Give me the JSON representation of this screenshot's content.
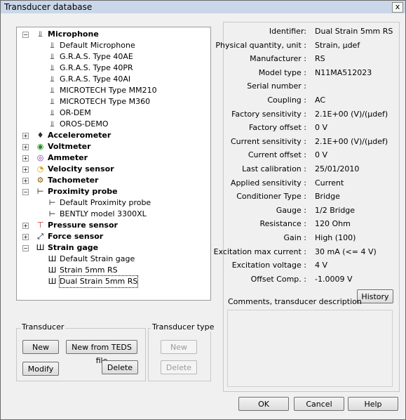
{
  "window": {
    "title": "Transducer database",
    "close": "x"
  },
  "tree": {
    "nodes": [
      {
        "label": "Microphone",
        "icon": "microphone-icon",
        "category": true,
        "expanded": true
      },
      {
        "label": "Default Microphone",
        "icon": "microphone-icon"
      },
      {
        "label": "G.R.A.S. Type 40AE",
        "icon": "microphone-icon"
      },
      {
        "label": "G.R.A.S. Type 40PR",
        "icon": "microphone-icon"
      },
      {
        "label": "G.R.A.S. Type 40AI",
        "icon": "microphone-icon"
      },
      {
        "label": "MICROTECH Type MM210",
        "icon": "microphone-icon"
      },
      {
        "label": "MICROTECH Type M360",
        "icon": "microphone-icon"
      },
      {
        "label": "OR-DEM",
        "icon": "microphone-icon"
      },
      {
        "label": "OROS-DEMO",
        "icon": "microphone-icon"
      },
      {
        "label": "Accelerometer",
        "icon": "accelerometer-icon",
        "category": true,
        "expanded": false
      },
      {
        "label": "Voltmeter",
        "icon": "voltmeter-icon",
        "category": true,
        "expanded": false
      },
      {
        "label": "Ammeter",
        "icon": "ammeter-icon",
        "category": true,
        "expanded": false
      },
      {
        "label": "Velocity sensor",
        "icon": "velocity-sensor-icon",
        "category": true,
        "expanded": false
      },
      {
        "label": "Tachometer",
        "icon": "tachometer-icon",
        "category": true,
        "expanded": false
      },
      {
        "label": "Proximity probe",
        "icon": "proximity-probe-icon",
        "category": true,
        "expanded": true
      },
      {
        "label": "Default Proximity probe",
        "icon": "proximity-probe-icon"
      },
      {
        "label": "BENTLY model 3300XL",
        "icon": "proximity-probe-icon"
      },
      {
        "label": "Pressure sensor",
        "icon": "pressure-sensor-icon",
        "category": true,
        "expanded": false
      },
      {
        "label": "Force sensor",
        "icon": "force-sensor-icon",
        "category": true,
        "expanded": false
      },
      {
        "label": "Strain gage",
        "icon": "strain-gage-icon",
        "category": true,
        "expanded": true
      },
      {
        "label": "Default Strain gage",
        "icon": "strain-gage-icon"
      },
      {
        "label": "Strain 5mm RS",
        "icon": "strain-gage-icon"
      },
      {
        "label": "Dual Strain 5mm RS",
        "icon": "strain-gage-icon",
        "selected": true
      }
    ]
  },
  "properties": [
    {
      "label": "Identifier:",
      "value": "Dual Strain 5mm RS"
    },
    {
      "label": "Physical quantity, unit :",
      "value": "Strain, µdef"
    },
    {
      "label": "Manufacturer :",
      "value": "RS"
    },
    {
      "label": "Model type :",
      "value": "N11MA512023"
    },
    {
      "label": "Serial number :",
      "value": ""
    },
    {
      "label": "Coupling :",
      "value": "AC"
    },
    {
      "label": "Factory sensitivity :",
      "value": "2.1E+00 (V)/(µdef)"
    },
    {
      "label": "Factory offset :",
      "value": "0 V"
    },
    {
      "label": "Current sensitivity :",
      "value": "2.1E+00 (V)/(µdef)"
    },
    {
      "label": "Current offset :",
      "value": "0 V"
    },
    {
      "label": "Last calibration :",
      "value": "25/01/2010"
    },
    {
      "label": "Applied sensitivity :",
      "value": "Current"
    },
    {
      "label": "Conditioner Type :",
      "value": "Bridge"
    },
    {
      "label": "Gauge :",
      "value": "1/2 Bridge"
    },
    {
      "label": "Resistance :",
      "value": "120 Ohm"
    },
    {
      "label": "Gain :",
      "value": "High (100)"
    },
    {
      "label": "Excitation max current :",
      "value": "30 mA (<= 4 V)"
    },
    {
      "label": "Excitation voltage :",
      "value": "4 V"
    },
    {
      "label": "Offset Comp. :",
      "value": "-1.0009 V"
    }
  ],
  "history_button": "History",
  "comments_label": "Comments, transducer description",
  "transducer_group": {
    "title": "Transducer",
    "new": "New",
    "new_teds": "New from TEDS file",
    "modify": "Modify",
    "delete": "Delete"
  },
  "type_group": {
    "title": "Transducer type",
    "new": "New",
    "delete": "Delete"
  },
  "footer": {
    "ok": "OK",
    "cancel": "Cancel",
    "help": "Help"
  }
}
